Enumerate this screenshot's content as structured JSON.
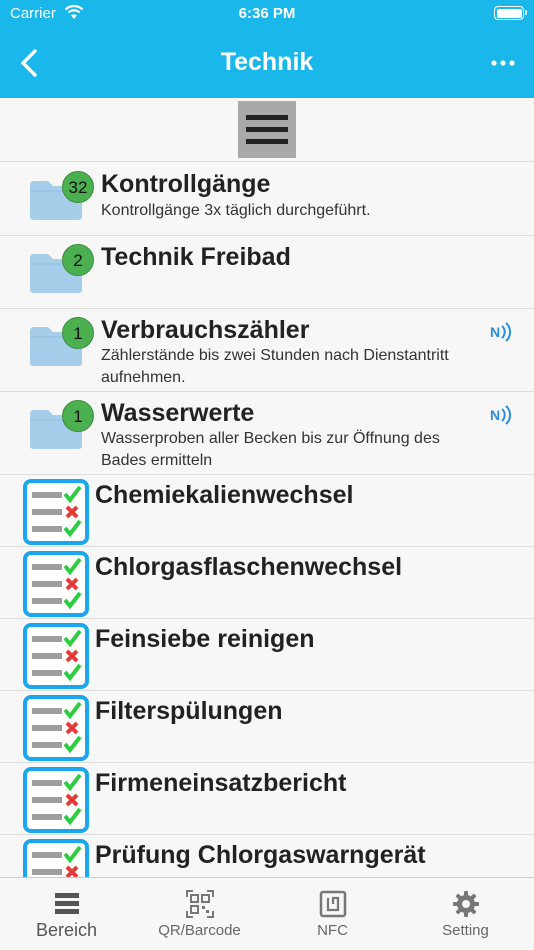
{
  "status_bar": {
    "carrier": "Carrier",
    "time": "6:36 PM"
  },
  "nav": {
    "title": "Technik"
  },
  "folders": [
    {
      "badge": "32",
      "title": "Kontrollgänge",
      "subtitle": "Kontrollgänge 3x täglich durchgeführt.",
      "nfc": false
    },
    {
      "badge": "2",
      "title": "Technik Freibad",
      "subtitle": "",
      "nfc": false
    },
    {
      "badge": "1",
      "title": "Verbrauchszähler",
      "subtitle": "Zählerstände bis zwei Stunden nach Dienstantritt aufnehmen.",
      "nfc": true
    },
    {
      "badge": "1",
      "title": "Wasserwerte",
      "subtitle": "Wasserproben aller Becken bis zur Öffnung des Bades ermitteln",
      "nfc": true
    }
  ],
  "tasks": [
    {
      "title": "Chemiekalienwechsel"
    },
    {
      "title": "Chlorgasflaschenwechsel"
    },
    {
      "title": "Feinsiebe reinigen"
    },
    {
      "title": "Filterspülungen"
    },
    {
      "title": "Firmeneinsatzbericht"
    },
    {
      "title": "Prüfung Chlorgaswarngerät"
    }
  ],
  "tabs": [
    {
      "label": "Bereich",
      "icon": "list-icon",
      "active": true
    },
    {
      "label": "QR/Barcode",
      "icon": "qr-code-icon",
      "active": false
    },
    {
      "label": "NFC",
      "icon": "nfc-tag-icon",
      "active": false
    },
    {
      "label": "Setting",
      "icon": "gear-icon",
      "active": false
    }
  ],
  "colors": {
    "accent": "#1ab7ea",
    "badge": "#4caf50",
    "folder": "#a6cdea",
    "check_frame": "#1aa7ee",
    "check_green": "#2ecc40",
    "cross_red": "#e53935",
    "nfc_blue": "#2a8de0"
  }
}
